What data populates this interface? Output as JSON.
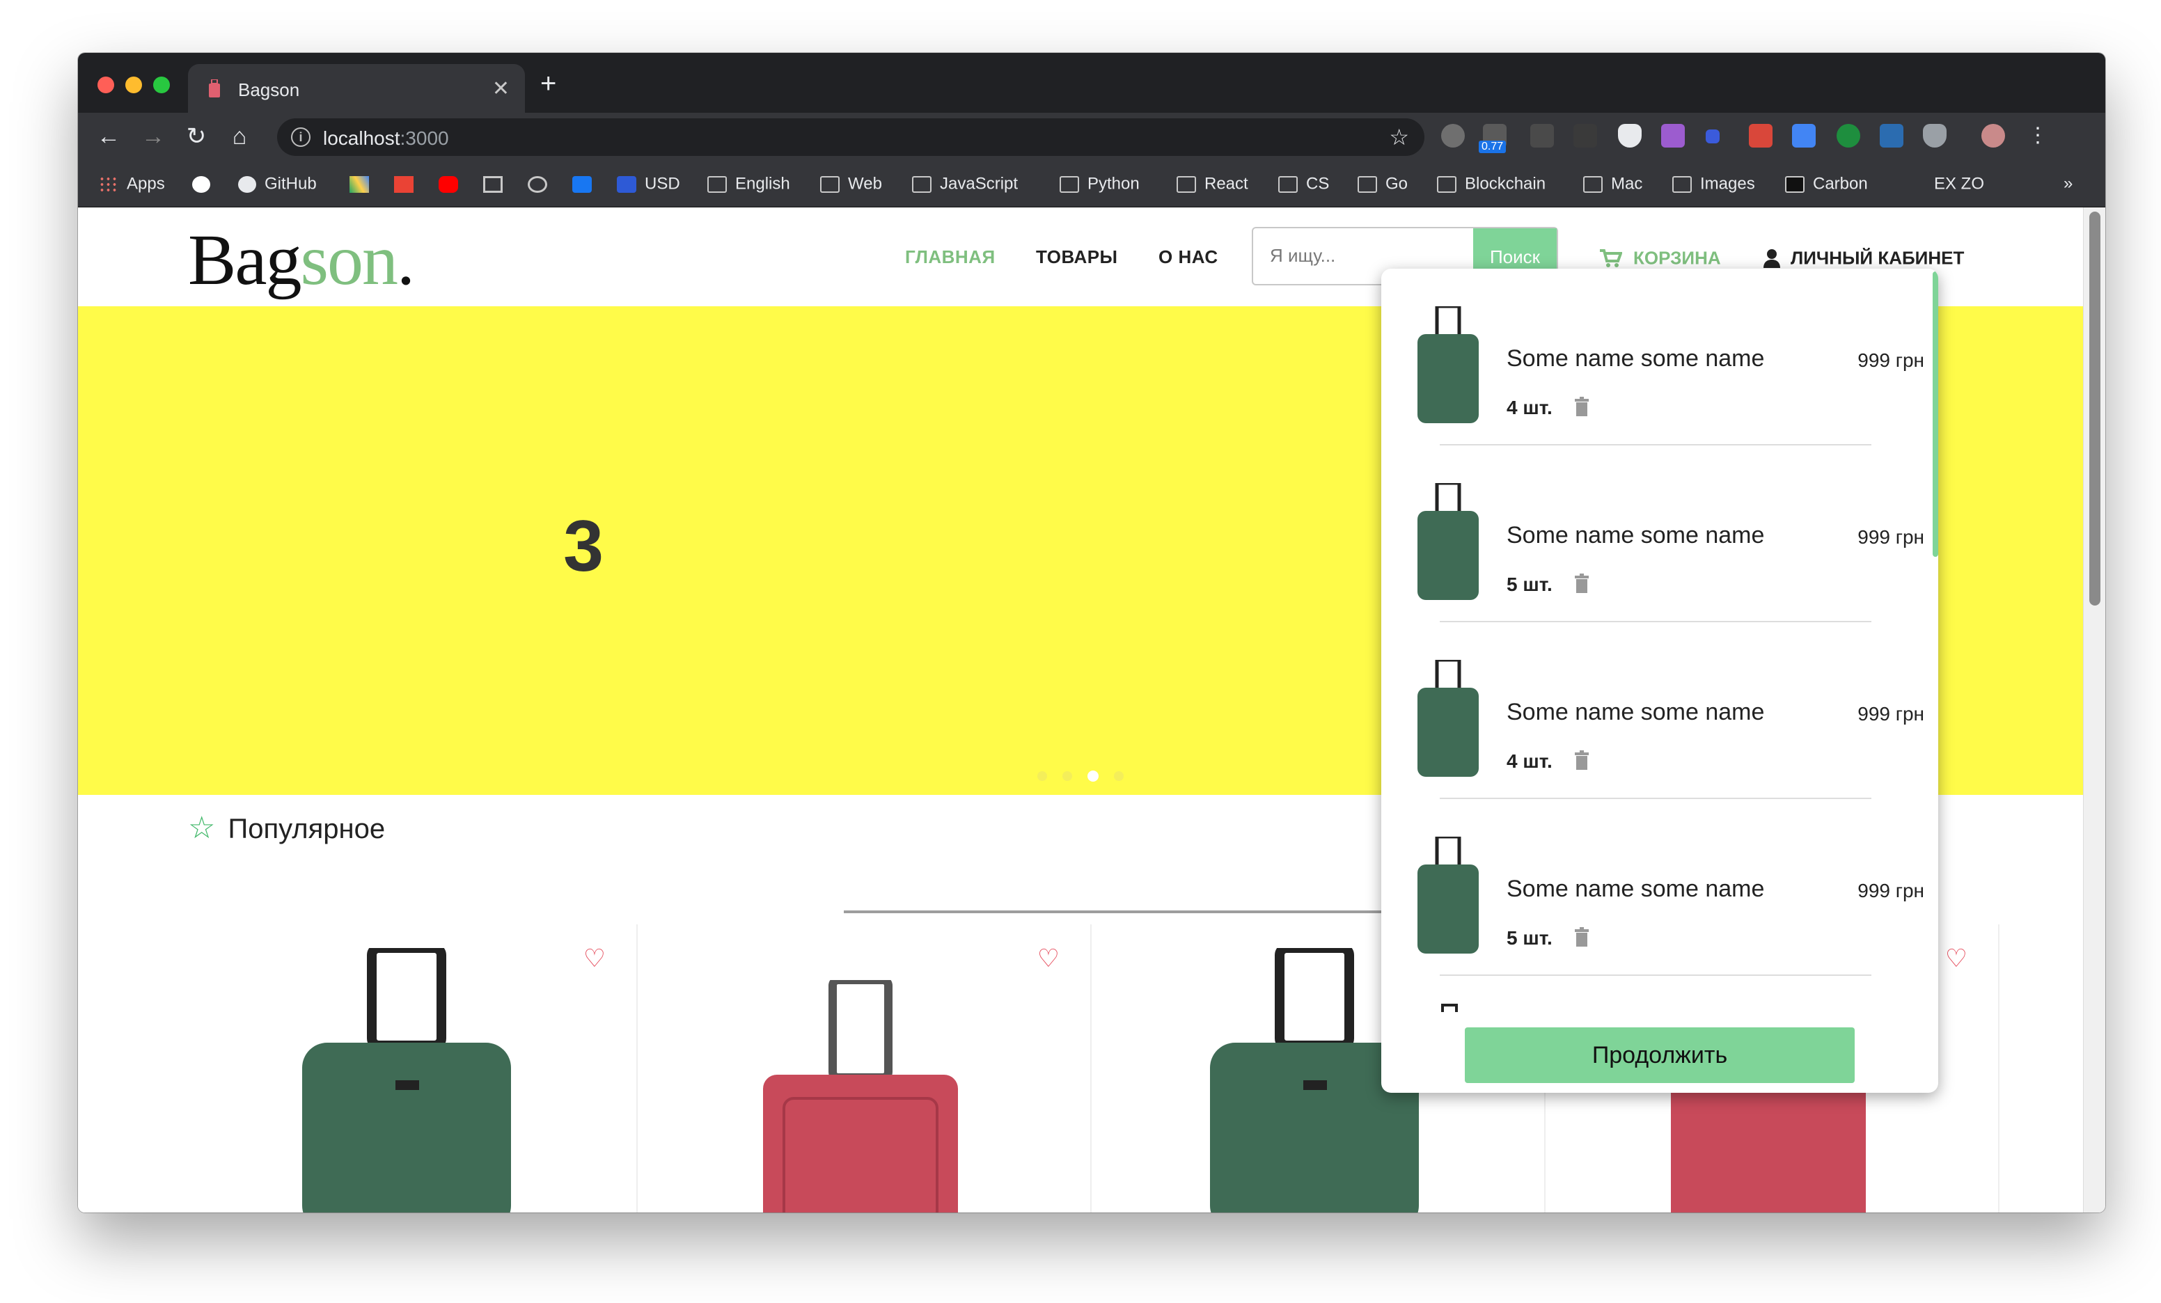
{
  "browser": {
    "tab_title": "Bagson",
    "tab_close": "✕",
    "new_tab": "+",
    "url_host": "localhost",
    "url_port": ":3000",
    "extension_badge": "0.77",
    "bookmarks": [
      {
        "label": "Apps",
        "icon": "apps-grid-icon"
      },
      {
        "label": "",
        "icon": "google-icon"
      },
      {
        "label": "GitHub",
        "icon": "github-icon"
      },
      {
        "label": "",
        "icon": "google-drive-icon"
      },
      {
        "label": "",
        "icon": "gmail-icon"
      },
      {
        "label": "",
        "icon": "youtube-icon"
      },
      {
        "label": "",
        "icon": "codesandbox-icon"
      },
      {
        "label": "",
        "icon": "swirl-icon"
      },
      {
        "label": "",
        "icon": "facebook-icon"
      },
      {
        "label": "USD",
        "icon": "info-icon"
      },
      {
        "label": "English",
        "icon": "folder-icon"
      },
      {
        "label": "Web",
        "icon": "folder-icon"
      },
      {
        "label": "JavaScript",
        "icon": "folder-icon"
      },
      {
        "label": "Python",
        "icon": "folder-icon"
      },
      {
        "label": "React",
        "icon": "folder-icon"
      },
      {
        "label": "CS",
        "icon": "folder-icon"
      },
      {
        "label": "Go",
        "icon": "folder-icon"
      },
      {
        "label": "Blockchain",
        "icon": "folder-icon"
      },
      {
        "label": "Mac",
        "icon": "folder-icon"
      },
      {
        "label": "Images",
        "icon": "folder-icon"
      },
      {
        "label": "Carbon",
        "icon": "carbon-icon"
      },
      {
        "label": "EX ZO",
        "icon": ""
      }
    ],
    "more_bookmarks": "»"
  },
  "site": {
    "logo_main": "Bag",
    "logo_accent": "son",
    "logo_dot": ".",
    "nav": {
      "home": "ГЛАВНАЯ",
      "products": "ТОВАРЫ",
      "about": "О НАС"
    },
    "search": {
      "placeholder": "Я ищу...",
      "button": "Поиск"
    },
    "cart_label": "КОРЗИНА",
    "account_label": "ЛИЧНЫЙ КАБИНЕТ",
    "hero": {
      "slide_number": "3",
      "slide_count": 4,
      "active_slide": 3
    },
    "popular_title": "Популярное"
  },
  "cart_dropdown": {
    "items": [
      {
        "name": "Some name some name",
        "price": "999 грн",
        "qty": "4 шт."
      },
      {
        "name": "Some name some name",
        "price": "999 грн",
        "qty": "5 шт."
      },
      {
        "name": "Some name some name",
        "price": "999 грн",
        "qty": "4 шт."
      },
      {
        "name": "Some name some name",
        "price": "999 грн",
        "qty": "5 шт."
      }
    ],
    "continue_button": "Продолжить"
  },
  "colors": {
    "accent_green": "#7fd498",
    "hero_yellow": "#fffb49",
    "heart_red": "#e54b5b"
  }
}
